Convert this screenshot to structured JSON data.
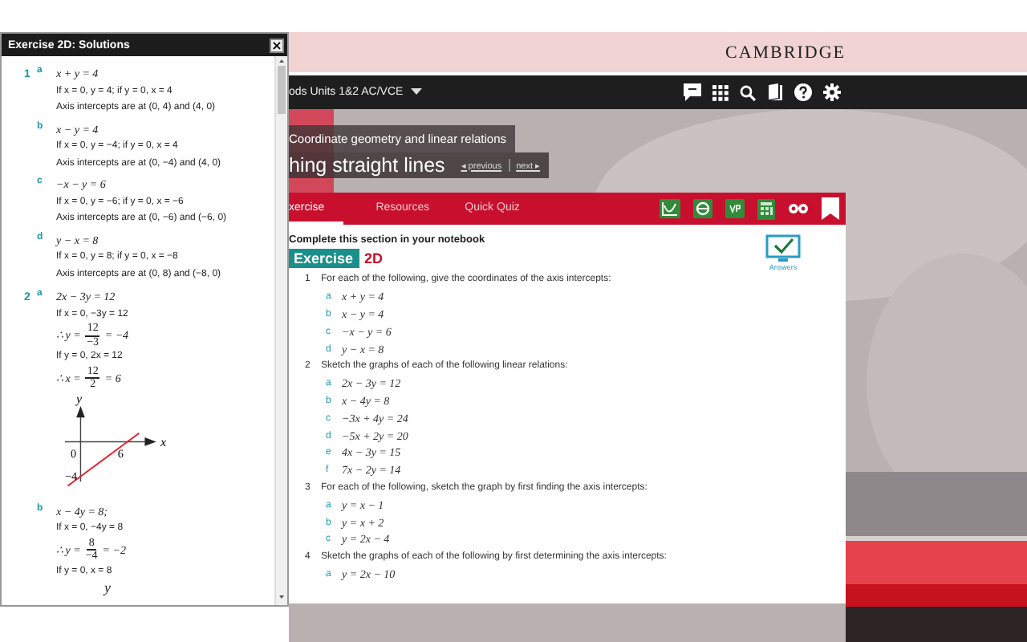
{
  "panel": {
    "title": "Exercise 2D: Solutions",
    "close": "×",
    "questions": [
      {
        "number": "1",
        "parts": [
          {
            "letter": "a",
            "lines": [
              {
                "kind": "math",
                "text": "x + y = 4"
              },
              {
                "kind": "text",
                "text": "If x = 0, y = 4; if y = 0, x = 4"
              },
              {
                "kind": "text",
                "text": "Axis intercepts are at (0, 4) and (4, 0)"
              }
            ]
          },
          {
            "letter": "b",
            "lines": [
              {
                "kind": "math",
                "text": "x − y = 4"
              },
              {
                "kind": "text",
                "text": "If x = 0, y = −4; if y = 0, x = 4"
              },
              {
                "kind": "text",
                "text": "Axis intercepts are at (0, −4) and (4, 0)"
              }
            ]
          },
          {
            "letter": "c",
            "lines": [
              {
                "kind": "math",
                "text": "−x − y = 6"
              },
              {
                "kind": "text",
                "text": "If x = 0, y = −6; if y = 0, x = −6"
              },
              {
                "kind": "text",
                "text": "Axis intercepts are at (0, −6) and (−6, 0)"
              }
            ]
          },
          {
            "letter": "d",
            "lines": [
              {
                "kind": "math",
                "text": "y − x = 8"
              },
              {
                "kind": "text",
                "text": "If x = 0, y = 8; if y = 0, x = −8"
              },
              {
                "kind": "text",
                "text": "Axis intercepts are at (0, 8) and (−8, 0)"
              }
            ]
          }
        ]
      },
      {
        "number": "2",
        "parts": [
          {
            "letter": "a",
            "lines": [
              {
                "kind": "math",
                "text": "2x − 3y = 12"
              },
              {
                "kind": "text",
                "text": "If x = 0, −3y = 12"
              },
              {
                "kind": "fraction",
                "prefix": "∴ y =",
                "num": "12",
                "den": "−3",
                "suffix": "= −4"
              },
              {
                "kind": "text",
                "text": "If y = 0, 2x = 12"
              },
              {
                "kind": "fraction",
                "prefix": "∴ x =",
                "num": "12",
                "den": "2",
                "suffix": "= 6"
              },
              {
                "kind": "graph",
                "y_axis": "y",
                "x_axis": "x",
                "origin": "0",
                "x_intercept": "6",
                "y_intercept": "−4"
              }
            ]
          },
          {
            "letter": "b",
            "lines": [
              {
                "kind": "math",
                "text": "x − 4y = 8;"
              },
              {
                "kind": "text",
                "text": "If x = 0, −4y = 8"
              },
              {
                "kind": "fraction",
                "prefix": "∴ y =",
                "num": "8",
                "den": "−4",
                "suffix": "= −2"
              },
              {
                "kind": "text",
                "text": "If y = 0, x = 8"
              },
              {
                "kind": "axis_label",
                "text": "y"
              }
            ]
          }
        ]
      }
    ]
  },
  "header": {
    "brand": "CAMBRIDGE"
  },
  "nav": {
    "course": "ods Units 1&2 AC/VCE"
  },
  "hero": {
    "chapter": "Coordinate geometry and linear relations",
    "section": "hing straight lines",
    "previous": "◂ previous",
    "next": "next ▸"
  },
  "tabs": [
    {
      "label": "xercise",
      "selected": true
    },
    {
      "label": "Resources",
      "selected": false
    },
    {
      "label": "Quick Quiz",
      "selected": false
    }
  ],
  "card": {
    "instruction": "Complete this section in your notebook",
    "exercise_label": "Exercise",
    "exercise_number": "2D",
    "answers_label": "Answers",
    "questions": [
      {
        "number": "1",
        "text": "For each of the following, give the coordinates of the axis intercepts:",
        "parts": [
          {
            "letter": "a",
            "text": "x + y = 4"
          },
          {
            "letter": "b",
            "text": "x − y = 4"
          },
          {
            "letter": "c",
            "text": "−x − y = 6"
          },
          {
            "letter": "d",
            "text": "y − x = 8"
          }
        ]
      },
      {
        "number": "2",
        "text": "Sketch the graphs of each of the following linear relations:",
        "parts": [
          {
            "letter": "a",
            "text": "2x − 3y = 12"
          },
          {
            "letter": "b",
            "text": "x − 4y = 8"
          },
          {
            "letter": "c",
            "text": "−3x + 4y = 24"
          },
          {
            "letter": "d",
            "text": "−5x + 2y = 20"
          },
          {
            "letter": "e",
            "text": "4x − 3y = 15"
          },
          {
            "letter": "f",
            "text": "7x − 2y = 14"
          }
        ]
      },
      {
        "number": "3",
        "text": "For each of the following, sketch the graph by first finding the axis intercepts:",
        "parts": [
          {
            "letter": "a",
            "text": "y = x − 1"
          },
          {
            "letter": "b",
            "text": "y = x + 2"
          },
          {
            "letter": "c",
            "text": "y = 2x − 4"
          }
        ]
      },
      {
        "number": "4",
        "text": "Sketch the graphs of each of the following by first determining the axis intercepts:",
        "parts": [
          {
            "letter": "a",
            "text": "y = 2x − 10"
          }
        ]
      }
    ]
  }
}
